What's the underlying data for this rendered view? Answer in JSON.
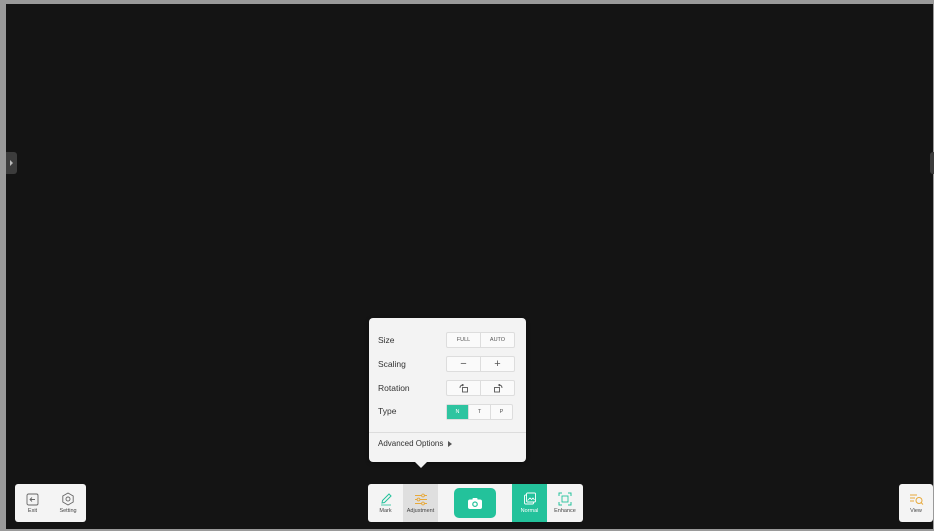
{
  "panel": {
    "size_label": "Size",
    "size_options": [
      "FULL",
      "AUTO"
    ],
    "scaling_label": "Scaling",
    "scaling_options": [
      "−",
      "+"
    ],
    "rotation_label": "Rotation",
    "type_label": "Type",
    "type_options": [
      "N",
      "T",
      "P"
    ],
    "type_selected": "N",
    "advanced_label": "Advanced Options"
  },
  "left_toolbar": {
    "exit_label": "Exit",
    "setting_label": "Setting"
  },
  "main_toolbar": {
    "mark_label": "Mark",
    "adjustment_label": "Adjustment",
    "normal_label": "Normal",
    "enhance_label": "Enhance"
  },
  "right_toolbar": {
    "view_label": "View"
  },
  "colors": {
    "accent": "#23c29b",
    "screen": "#141414",
    "panel": "#f3f3f3"
  }
}
